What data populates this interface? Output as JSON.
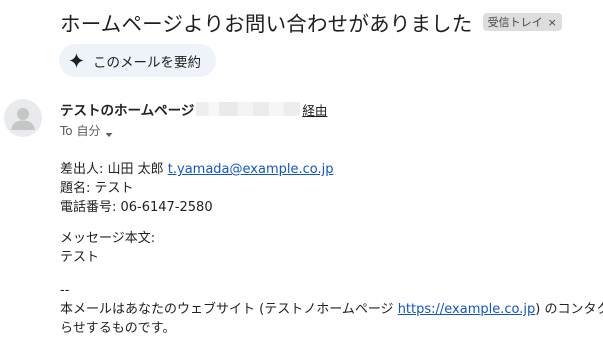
{
  "email": {
    "subject": "ホームページよりお問い合わせがありました",
    "label_chip": "受信トレイ",
    "label_close": "×",
    "summarize_label": "このメールを要約",
    "sender_name": "テストのホームページ",
    "via_text": "経由",
    "to_text": "To 自分"
  },
  "body": {
    "name_label": "差出人: 山田 太郎 ",
    "name_email": "t.yamada@example.co.jp",
    "subject_line": "題名: テスト",
    "phone_line": "電話番号: 06-6147-2580",
    "message_label": "メッセージ本文:",
    "message_text": "テスト",
    "signature_sep": "--",
    "footer_prefix": "本メールはあなたのウェブサイト (テストノホームページ ",
    "footer_link": "https://example.co.jp",
    "footer_suffix": ") のコンタクトフ",
    "footer_line2": "らせするものです。"
  },
  "icons": {
    "sparkle": "sparkle-icon",
    "avatar": "person-avatar-icon",
    "caret": "caret-down-icon"
  },
  "colors": {
    "link": "#1a0dab",
    "chip_bg": "#dddddd",
    "summarize_bg": "#eef2f9",
    "avatar_bg": "#e8eaed"
  }
}
